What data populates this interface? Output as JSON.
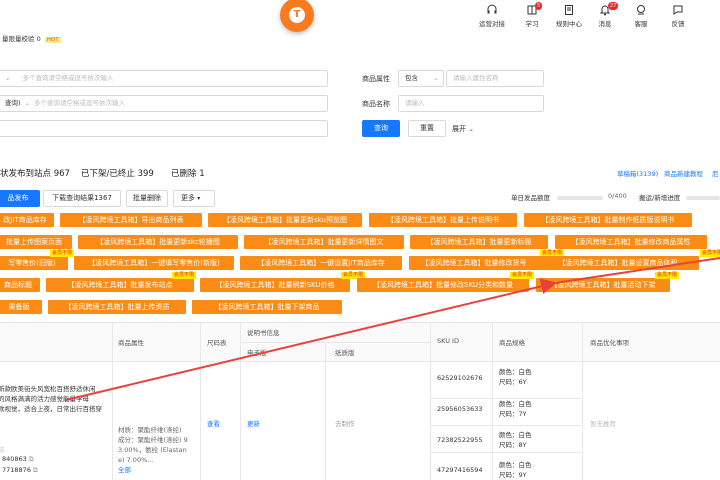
{
  "header": {
    "items": [
      {
        "label": "运营对接",
        "icon": "headset-icon"
      },
      {
        "label": "学习",
        "icon": "book-icon",
        "badge": "5"
      },
      {
        "label": "规则中心",
        "icon": "rules-icon"
      },
      {
        "label": "消息",
        "icon": "bell-icon",
        "badge": "27"
      },
      {
        "label": "客服",
        "icon": "service-icon"
      },
      {
        "label": "反馈",
        "icon": "feedback-icon"
      }
    ]
  },
  "top": {
    "label": "量限量校验",
    "value": "0",
    "hot": "HOT"
  },
  "filters": {
    "placeholder1": "多个查询请空格或逗号依次输入",
    "label2": "查询)",
    "placeholder2": "多个查询请空格或逗号依次输入",
    "attr_label": "商品属性",
    "attr_select": "包含",
    "attr_placeholder": "请输入属性名称",
    "name_label": "商品名称",
    "name_placeholder": "请输入",
    "query": "查询",
    "reset": "重置",
    "expand": "展开"
  },
  "status": {
    "text1": "状发布到站点 967",
    "text2": "已下架/已终止 399",
    "text3": "已删除 1",
    "right1": "草稿箱(3139)",
    "right2": "商品新建教程",
    "right3": "厄"
  },
  "actions": {
    "publish": "品发布",
    "download": "下载查询结果1367",
    "batch_delete": "批量删除",
    "more": "更多",
    "daily_label": "单日发品额度",
    "daily_value": "0/400",
    "progress_label": "搬运/新增进度"
  },
  "tools": {
    "r1": [
      "改JIT商品库存",
      "【凌风跨境工具箱】导出商品列表",
      "【凌风跨境工具箱】批量更新sku预览图",
      "【凌风跨境工具箱】批量上传说明书",
      "【凌风跨境工具箱】批量制作纸质版说明书"
    ],
    "r2": [
      "批量上传图案页面",
      "【凌风跨境工具箱】批量更新skc轮播图",
      "【凌风跨境工具箱】批量更新详情图文",
      "【凌风跨境工具箱】批量更新标题",
      "【凌风跨境工具箱】批量修改商品属性"
    ],
    "r3": [
      "写零售价(旧版)",
      "【凌风跨境工具箱】一键填写零售价(新版)",
      "【凌风跨境工具箱】一键设置JIT商品库存",
      "【凌风跨境工具箱】批量修改货号",
      "【凌风跨境工具箱】批量设置商品体积"
    ],
    "r4": [
      "商品标题",
      "【凌风跨境工具箱】批量发布站点",
      "【凌风跨境工具箱】批量刷新SKU价格",
      "【凌风跨境工具箱】批量修改SKU分类和数量",
      "【凌风跨境工具箱】批量活动下架"
    ],
    "r5": [
      "果备版",
      "【凌风跨境工具箱】批量上传资质",
      "【凌风跨境工具箱】批量下架商品"
    ],
    "tag": "会员不限"
  },
  "table": {
    "headers": {
      "attr": "商品属性",
      "size": "尺码表",
      "manual": "说明书信息",
      "electronic": "电子版",
      "paper": "纸质版",
      "sku": "SKU ID",
      "spec": "商品规格",
      "opt": "商品优化事项"
    },
    "product_desc": [
      "新款欧美街头风宽松百搭舒适休闲",
      "的风格满满的活力感觉能量学母",
      "款视觉，适合上夜，日常出行百搭穿"
    ],
    "id1": "840863",
    "id2": "7718876",
    "attr_text": [
      "材质：聚酯纤维(涤纶)",
      "成分：聚酯纤维(涤纶) 9",
      "3.00%，氨纶 (Elastan",
      "e) 7.00%..."
    ],
    "attr_all": "全部",
    "size_link": "查看",
    "elec_link": "更新",
    "paper_link": "去制作",
    "skus": [
      {
        "id": "62529102676",
        "color": "颜色：白色",
        "size": "尺码：6Y"
      },
      {
        "id": "25956053633",
        "color": "颜色：白色",
        "size": "尺码：7Y"
      },
      {
        "id": "72382522955",
        "color": "颜色：白色",
        "size": "尺码：8Y"
      },
      {
        "id": "47297416594",
        "color": "颜色：白色",
        "size": "尺码：9Y"
      }
    ],
    "opt_text": "暂无推荐"
  }
}
